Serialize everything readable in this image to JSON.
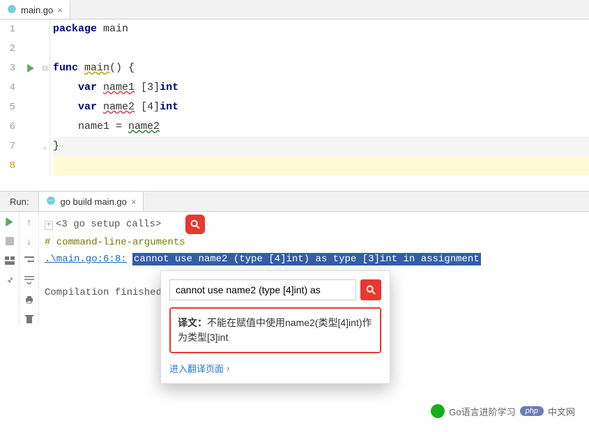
{
  "tab": {
    "filename": "main.go"
  },
  "code": {
    "lines": [
      {
        "n": "1",
        "html": "<span class='kw'>package</span> main"
      },
      {
        "n": "2",
        "html": ""
      },
      {
        "n": "3",
        "html": "<span class='kw'>func</span> <span class='ident-warn'>main</span>() {"
      },
      {
        "n": "4",
        "html": "    <span class='kw'>var</span> <span class='ident-err'>name1</span> [<span>3</span>]<span class='kw'>int</span>"
      },
      {
        "n": "5",
        "html": "    <span class='kw'>var</span> <span class='ident-err'>name2</span> [<span>4</span>]<span class='kw'>int</span>"
      },
      {
        "n": "6",
        "html": "    name1 = <span class='ident-green'>name2</span>"
      },
      {
        "n": "7",
        "html": "}"
      },
      {
        "n": "8",
        "html": ""
      }
    ]
  },
  "run": {
    "panel_title": "Run:",
    "tab_label": "go build main.go",
    "console": {
      "setup": "<3 go setup calls>",
      "cmd": "# command-line-arguments",
      "loc": ".\\main.go:6:8:",
      "err": "cannot use name2 (type [4]int) as type [3]int in assignment",
      "finish": "Compilation finished"
    }
  },
  "popup": {
    "query": "cannot use name2 (type [4]int) as",
    "translation_label": "译文：",
    "translation_text": "不能在赋值中使用name2(类型[4]int)作为类型[3]int",
    "link": "进入翻译页面"
  },
  "watermark": {
    "text1": "Go语言进阶学习",
    "text2": "中文网"
  }
}
